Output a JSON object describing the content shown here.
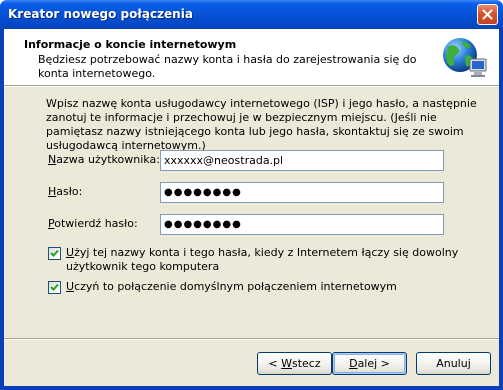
{
  "window": {
    "title": "Kreator nowego połączenia"
  },
  "header": {
    "title": "Informacje o koncie internetowym",
    "subtitle": "Będziesz potrzebować nazwy konta i hasła do zarejestrowania się do konta internetowego.",
    "icon": "globe-network-icon"
  },
  "body": {
    "intro": "Wpisz nazwę konta usługodawcy internetowego (ISP) i jego hasło, a następnie zanotuj te informacje i przechowuj je w bezpiecznym miejscu. (Jeśli nie pamiętasz nazwy istniejącego konta lub jego hasła, skontaktuj się ze swoim usługodawcą internetowym.)",
    "fields": {
      "username": {
        "label_accel": "N",
        "label_rest": "azwa użytkownika:",
        "value": "xxxxxx@neostrada.pl"
      },
      "password": {
        "label_accel": "H",
        "label_rest": "asło:",
        "value": "●●●●●●●●"
      },
      "confirm": {
        "label_accel": "P",
        "label_rest": "otwierdź hasło:",
        "value": "●●●●●●●●"
      }
    },
    "checkboxes": {
      "use_for_all": {
        "checked": true,
        "accel": "U",
        "rest": "żyj tej nazwy konta i tego hasła, kiedy z Internetem łączy się dowolny użytkownik tego komputera"
      },
      "make_default": {
        "checked": true,
        "accel": "U",
        "rest": "czyń to połączenie domyślnym połączeniem internetowym"
      }
    }
  },
  "buttons": {
    "back": {
      "prefix": "< ",
      "accel": "W",
      "rest": "stecz"
    },
    "next": {
      "accel": "D",
      "rest": "alej >"
    },
    "cancel": {
      "label": "Anuluj"
    }
  }
}
